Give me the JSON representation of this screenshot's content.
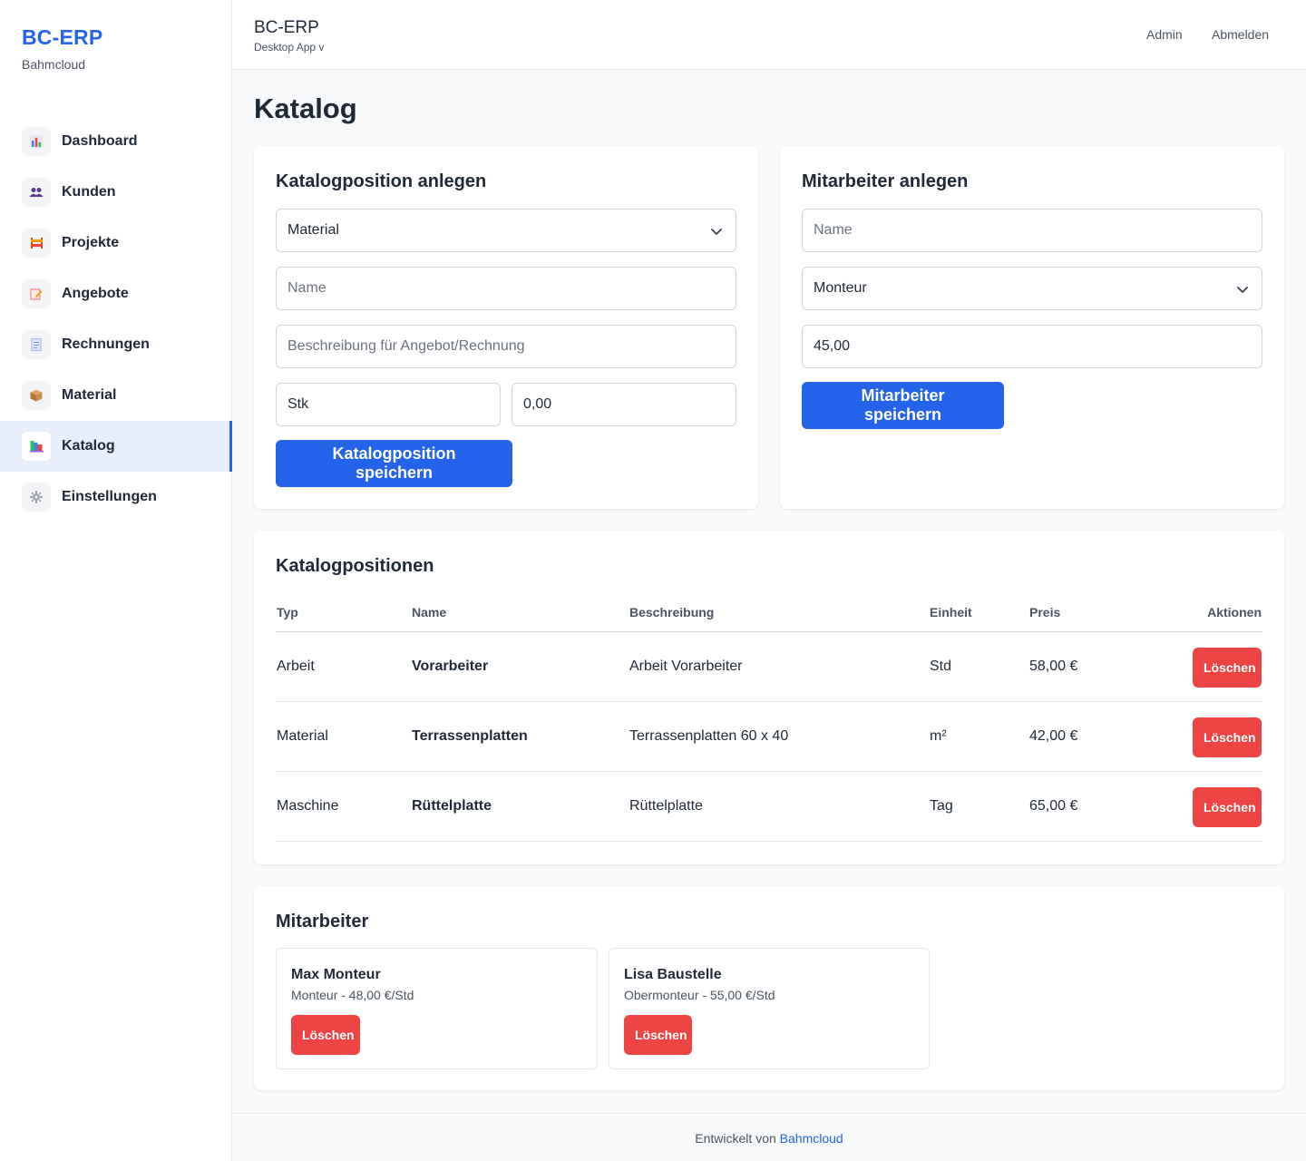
{
  "brand": {
    "title": "BC-ERP",
    "subtitle": "Bahmcloud"
  },
  "sidebar": {
    "items": [
      {
        "label": "Dashboard",
        "icon": "bar-chart-icon",
        "active": false
      },
      {
        "label": "Kunden",
        "icon": "users-icon",
        "active": false
      },
      {
        "label": "Projekte",
        "icon": "construction-icon",
        "active": false
      },
      {
        "label": "Angebote",
        "icon": "memo-icon",
        "active": false
      },
      {
        "label": "Rechnungen",
        "icon": "receipt-icon",
        "active": false
      },
      {
        "label": "Material",
        "icon": "package-icon",
        "active": false
      },
      {
        "label": "Katalog",
        "icon": "books-icon",
        "active": true
      },
      {
        "label": "Einstellungen",
        "icon": "gear-icon",
        "active": false
      }
    ]
  },
  "header": {
    "title": "BC-ERP",
    "subtitle": "Desktop App v",
    "admin_link": "Admin",
    "logout_link": "Abmelden"
  },
  "page": {
    "title": "Katalog"
  },
  "catalog_form": {
    "title": "Katalogposition anlegen",
    "type_value": "Material",
    "name_placeholder": "Name",
    "description_placeholder": "Beschreibung für Angebot/Rechnung",
    "unit_value": "Stk",
    "price_value": "0,00",
    "save_label": "Katalogposition speichern"
  },
  "employee_form": {
    "title": "Mitarbeiter anlegen",
    "name_placeholder": "Name",
    "role_value": "Monteur",
    "rate_value": "45,00",
    "save_label": "Mitarbeiter speichern"
  },
  "catalog_table": {
    "title": "Katalogpositionen",
    "headers": {
      "type": "Typ",
      "name": "Name",
      "description": "Beschreibung",
      "unit": "Einheit",
      "price": "Preis",
      "actions": "Aktionen"
    },
    "rows": [
      {
        "type": "Arbeit",
        "name": "Vorarbeiter",
        "description": "Arbeit Vorarbeiter",
        "unit": "Std",
        "price": "58,00 €",
        "action": "Löschen"
      },
      {
        "type": "Material",
        "name": "Terrassenplatten",
        "description": "Terrassenplatten 60 x 40",
        "unit": "m²",
        "price": "42,00 €",
        "action": "Löschen"
      },
      {
        "type": "Maschine",
        "name": "Rüttelplatte",
        "description": "Rüttelplatte",
        "unit": "Tag",
        "price": "65,00 €",
        "action": "Löschen"
      }
    ]
  },
  "employees": {
    "title": "Mitarbeiter",
    "items": [
      {
        "name": "Max Monteur",
        "detail": "Monteur - 48,00 €/Std",
        "action": "Löschen"
      },
      {
        "name": "Lisa Baustelle",
        "detail": "Obermonteur - 55,00 €/Std",
        "action": "Löschen"
      }
    ]
  },
  "footer": {
    "text": "Entwickelt von",
    "link": "Bahmcloud"
  },
  "colors": {
    "accent": "#2563eb",
    "danger": "#ef4444",
    "active_bg": "#e8eefc",
    "background": "#f8f9fb"
  }
}
